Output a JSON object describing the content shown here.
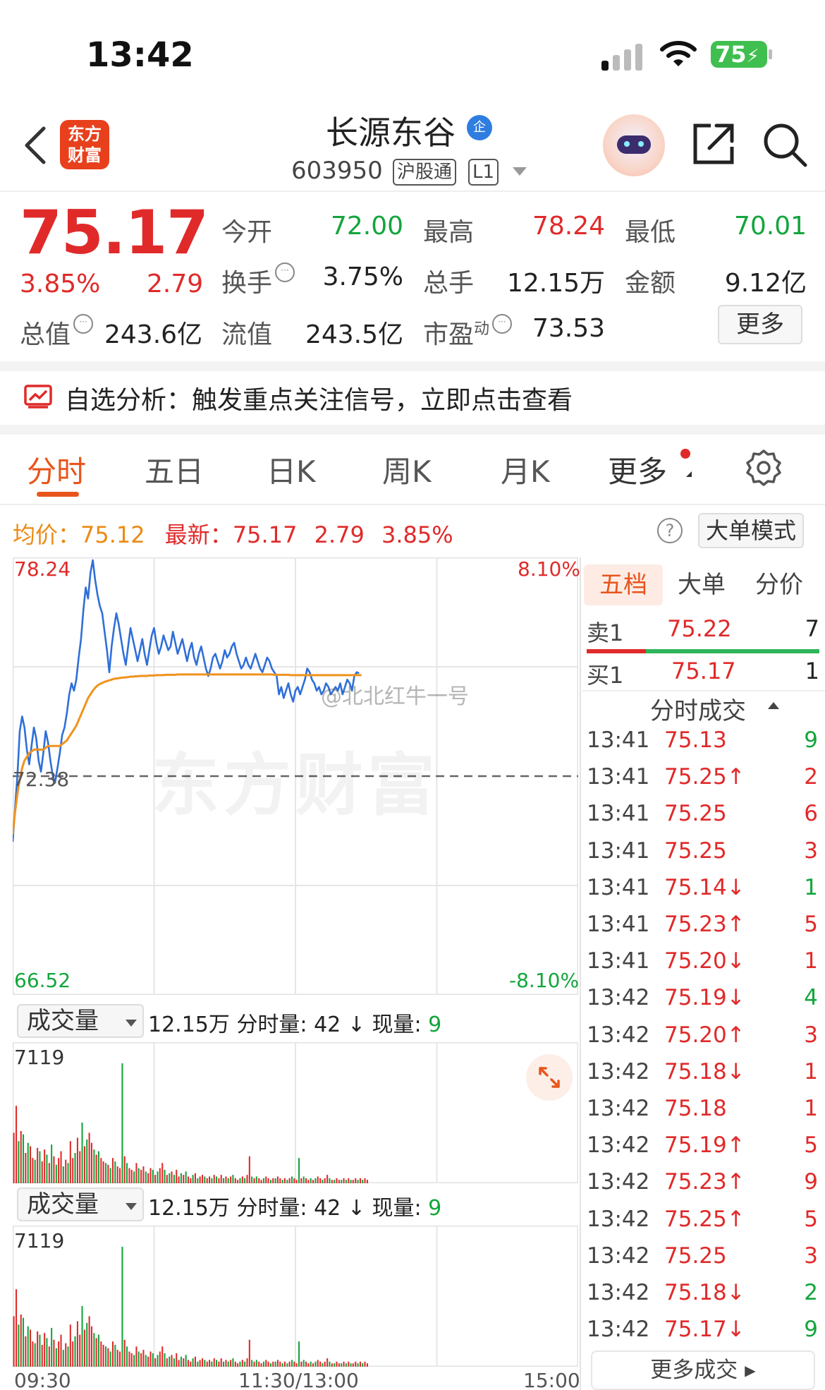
{
  "status": {
    "time": "13:42",
    "battery": "75"
  },
  "header": {
    "logo_line1": "东方",
    "logo_line2": "财富",
    "stock_name": "长源东谷",
    "verified_badge": "企",
    "stock_code": "603950",
    "tag_connect": "沪股通",
    "tag_level": "L1"
  },
  "quote": {
    "price": "75.17",
    "change_pct": "3.85%",
    "change_amt": "2.79",
    "total_value_label": "总值",
    "total_value": "243.6亿",
    "open_label": "今开",
    "open": "72.00",
    "high_label": "最高",
    "high": "78.24",
    "low_label": "最低",
    "low": "70.01",
    "turnover_label": "换手",
    "turnover": "3.75%",
    "volume_label": "总手",
    "volume": "12.15万",
    "amount_label": "金额",
    "amount": "9.12亿",
    "float_label": "流值",
    "float_value": "243.5亿",
    "pe_label": "市盈",
    "pe_sup": "动",
    "pe": "73.53",
    "more_button": "更多"
  },
  "analysis": {
    "text": "自选分析：触发重点关注信号，立即点击查看"
  },
  "tabs": [
    "分时",
    "五日",
    "日K",
    "周K",
    "月K",
    "更多"
  ],
  "avg_row": {
    "avg_label": "均价：",
    "avg_value": "75.12",
    "latest_label": "最新：",
    "latest_value": "75.17",
    "latest_change": "2.79",
    "latest_pct": "3.85%",
    "help": "?",
    "bigorder_button": "大单模式"
  },
  "watermark": {
    "user": "@北北红牛一号",
    "brand": "东方财富"
  },
  "chart_data": {
    "type": "line",
    "y_max_label": "78.24",
    "y_min_label": "66.52",
    "pct_max_label": "8.10%",
    "pct_min_label": "-8.10%",
    "prev_close_label": "72.38",
    "ylim": [
      66.52,
      78.24
    ],
    "prev_close": 72.38,
    "x_ticks": [
      "09:30",
      "11:30/13:00",
      "15:00"
    ],
    "total_minutes": 240,
    "series": [
      {
        "color": "#2f6fd8",
        "values": [
          70.6,
          71.5,
          72.4,
          73.6,
          74.0,
          73.7,
          73.1,
          72.7,
          73.2,
          73.7,
          73.4,
          72.8,
          72.5,
          73.0,
          73.6,
          73.3,
          72.8,
          72.4,
          72.2,
          72.6,
          73.0,
          73.5,
          73.7,
          74.1,
          74.6,
          74.9,
          74.7,
          75.0,
          75.6,
          76.1,
          76.9,
          77.5,
          77.2,
          77.9,
          78.24,
          77.7,
          77.3,
          77.0,
          76.8,
          76.3,
          75.8,
          75.2,
          75.9,
          76.4,
          76.8,
          76.5,
          76.1,
          75.7,
          75.4,
          75.9,
          76.4,
          76.1,
          75.8,
          75.5,
          75.8,
          76.1,
          75.7,
          75.4,
          75.8,
          76.2,
          76.4,
          76.0,
          75.7,
          75.9,
          76.2,
          76.0,
          75.8,
          75.9,
          76.3,
          76.0,
          75.7,
          75.9,
          76.1,
          75.8,
          75.5,
          75.8,
          76.0,
          75.6,
          75.4,
          75.7,
          75.9,
          75.6,
          75.3,
          75.1,
          75.3,
          75.6,
          75.7,
          75.5,
          75.3,
          75.5,
          75.8,
          75.6,
          75.7,
          75.9,
          76.0,
          75.7,
          75.5,
          75.3,
          75.4,
          75.6,
          75.4,
          75.3,
          75.5,
          75.7,
          75.5,
          75.3,
          75.2,
          75.4,
          75.6,
          75.5,
          75.3,
          75.2,
          75.1,
          74.6,
          74.8,
          74.5,
          74.7,
          74.9,
          74.6,
          74.4,
          74.7,
          74.8,
          74.6,
          74.8,
          75.0,
          75.3,
          75.2,
          75.0,
          74.9,
          74.7,
          74.8,
          74.6,
          74.7,
          74.9,
          74.8,
          74.6,
          74.7,
          74.8,
          74.7,
          74.9,
          74.6,
          74.8,
          75.0,
          74.9,
          74.7,
          75.1,
          75.2,
          75.17
        ]
      },
      {
        "color": "#f0921c",
        "values": [
          70.8,
          71.4,
          71.9,
          72.3,
          72.6,
          72.8,
          72.9,
          73.0,
          73.05,
          73.1,
          73.1,
          73.1,
          73.1,
          73.1,
          73.15,
          73.2,
          73.2,
          73.2,
          73.2,
          73.2,
          73.2,
          73.25,
          73.3,
          73.35,
          73.45,
          73.55,
          73.65,
          73.75,
          73.9,
          74.05,
          74.2,
          74.35,
          74.5,
          74.6,
          74.7,
          74.78,
          74.84,
          74.88,
          74.91,
          74.94,
          74.96,
          74.98,
          75.0,
          75.02,
          75.03,
          75.04,
          75.05,
          75.06,
          75.06,
          75.07,
          75.08,
          75.08,
          75.09,
          75.09,
          75.1,
          75.1,
          75.1,
          75.1,
          75.11,
          75.11,
          75.11,
          75.12,
          75.12,
          75.12,
          75.12,
          75.13,
          75.13,
          75.13,
          75.13,
          75.13,
          75.14,
          75.14,
          75.14,
          75.14,
          75.14,
          75.14,
          75.14,
          75.14,
          75.14,
          75.14,
          75.14,
          75.14,
          75.14,
          75.14,
          75.14,
          75.14,
          75.14,
          75.14,
          75.14,
          75.14,
          75.14,
          75.14,
          75.14,
          75.14,
          75.14,
          75.14,
          75.14,
          75.14,
          75.14,
          75.14,
          75.14,
          75.14,
          75.14,
          75.14,
          75.14,
          75.14,
          75.14,
          75.14,
          75.14,
          75.14,
          75.14,
          75.13,
          75.13,
          75.13,
          75.13,
          75.13,
          75.13,
          75.13,
          75.12,
          75.12,
          75.12,
          75.12,
          75.12,
          75.12,
          75.12,
          75.12,
          75.12,
          75.12,
          75.12,
          75.12,
          75.12,
          75.12,
          75.12,
          75.12,
          75.12,
          75.12,
          75.12,
          75.12,
          75.12,
          75.12,
          75.12,
          75.12,
          75.12,
          75.12,
          75.12,
          75.12,
          75.12,
          75.12,
          75.12
        ]
      }
    ]
  },
  "volume_data": {
    "type": "bar",
    "button_label": "成交量",
    "total": "12.15万",
    "minute_label": "分时量:",
    "minute_value": "42",
    "minute_arrow": "↓",
    "current_label": "现量:",
    "current_value": "9",
    "y_max_label": "7119",
    "ymax": 7119,
    "total_minutes": 240,
    "values": [
      3000,
      4600,
      2500,
      3100,
      2900,
      1800,
      2400,
      2200,
      1500,
      1400,
      2100,
      1900,
      1300,
      2000,
      1700,
      1200,
      2300,
      1600,
      1100,
      1500,
      1900,
      1000,
      1400,
      1200,
      2500,
      1500,
      1800,
      2700,
      1900,
      3600,
      2200,
      2600,
      3000,
      2400,
      2000,
      1700,
      1900,
      1500,
      1300,
      1200,
      1100,
      900,
      1500,
      1300,
      1000,
      900,
      7119,
      1600,
      1200,
      900,
      800,
      700,
      1200,
      900,
      800,
      1000,
      700,
      600,
      900,
      800,
      500,
      700,
      900,
      1200,
      800,
      500,
      600,
      700,
      500,
      800,
      400,
      600,
      500,
      700,
      400,
      300,
      500,
      600,
      300,
      400,
      500,
      400,
      300,
      400,
      300,
      500,
      400,
      300,
      500,
      300,
      400,
      300,
      400,
      500,
      300,
      200,
      300,
      400,
      300,
      500,
      1600,
      400,
      300,
      400,
      300,
      200,
      300,
      400,
      300,
      200,
      300,
      300,
      400,
      300,
      200,
      300,
      200,
      300,
      400,
      300,
      200,
      1500,
      300,
      400,
      300,
      200,
      300,
      200,
      300,
      400,
      300,
      200,
      300,
      500,
      300,
      200,
      200,
      300,
      200,
      200,
      300,
      200,
      300,
      200,
      200,
      300,
      200,
      300,
      200,
      300,
      200
    ],
    "colors": [
      "r",
      "r",
      "g",
      "r",
      "g",
      "r",
      "g",
      "r",
      "r",
      "g",
      "r",
      "g",
      "r",
      "r",
      "g",
      "r",
      "g",
      "r",
      "g",
      "r",
      "r",
      "g",
      "r",
      "g",
      "r",
      "r",
      "g",
      "r",
      "r",
      "g",
      "r",
      "g",
      "r",
      "r",
      "g",
      "r",
      "g",
      "r",
      "r",
      "g",
      "r",
      "g",
      "r",
      "g",
      "r",
      "r",
      "g",
      "r",
      "g",
      "r",
      "r",
      "g",
      "r",
      "g",
      "r",
      "r",
      "g",
      "r",
      "r",
      "g",
      "r",
      "g",
      "r",
      "r",
      "g",
      "r",
      "g",
      "r",
      "g",
      "r",
      "r",
      "g",
      "r",
      "g",
      "r",
      "r",
      "g",
      "r",
      "g",
      "r",
      "r",
      "g",
      "r",
      "r",
      "g",
      "r",
      "g",
      "r",
      "r",
      "g",
      "r",
      "g",
      "r",
      "g",
      "r",
      "r",
      "g",
      "r",
      "g",
      "r",
      "r",
      "g",
      "r",
      "g",
      "r",
      "r",
      "g",
      "r",
      "r",
      "g",
      "r",
      "g",
      "r",
      "r",
      "g",
      "r",
      "g",
      "r",
      "g",
      "r",
      "r",
      "g",
      "r",
      "g",
      "r",
      "r",
      "g",
      "r",
      "g",
      "r",
      "r",
      "g",
      "r",
      "r",
      "g",
      "r",
      "g",
      "r",
      "r",
      "g",
      "r",
      "g",
      "r",
      "g",
      "r",
      "r",
      "g",
      "r",
      "g",
      "r",
      "r",
      "g",
      "r"
    ]
  },
  "panel": {
    "tabs": [
      "五档",
      "大单",
      "分价"
    ],
    "sell1": {
      "label": "卖1",
      "price": "75.22",
      "qty": "7"
    },
    "buy1": {
      "label": "买1",
      "price": "75.17",
      "qty": "1"
    },
    "trade_title": "分时成交",
    "trades": [
      {
        "t": "13:41",
        "p": "75.13",
        "v": "9",
        "pc": "r",
        "vc": "g"
      },
      {
        "t": "13:41",
        "p": "75.25↑",
        "v": "2",
        "pc": "r",
        "vc": "r"
      },
      {
        "t": "13:41",
        "p": "75.25",
        "v": "6",
        "pc": "r",
        "vc": "r"
      },
      {
        "t": "13:41",
        "p": "75.25",
        "v": "3",
        "pc": "r",
        "vc": "r"
      },
      {
        "t": "13:41",
        "p": "75.14↓",
        "v": "1",
        "pc": "r",
        "vc": "g"
      },
      {
        "t": "13:41",
        "p": "75.23↑",
        "v": "5",
        "pc": "r",
        "vc": "r"
      },
      {
        "t": "13:41",
        "p": "75.20↓",
        "v": "1",
        "pc": "r",
        "vc": "r"
      },
      {
        "t": "13:42",
        "p": "75.19↓",
        "v": "4",
        "pc": "r",
        "vc": "g"
      },
      {
        "t": "13:42",
        "p": "75.20↑",
        "v": "3",
        "pc": "r",
        "vc": "r"
      },
      {
        "t": "13:42",
        "p": "75.18↓",
        "v": "1",
        "pc": "r",
        "vc": "r"
      },
      {
        "t": "13:42",
        "p": "75.18",
        "v": "1",
        "pc": "r",
        "vc": "r"
      },
      {
        "t": "13:42",
        "p": "75.19↑",
        "v": "5",
        "pc": "r",
        "vc": "r"
      },
      {
        "t": "13:42",
        "p": "75.23↑",
        "v": "9",
        "pc": "r",
        "vc": "r"
      },
      {
        "t": "13:42",
        "p": "75.25↑",
        "v": "5",
        "pc": "r",
        "vc": "r"
      },
      {
        "t": "13:42",
        "p": "75.25",
        "v": "3",
        "pc": "r",
        "vc": "r"
      },
      {
        "t": "13:42",
        "p": "75.18↓",
        "v": "2",
        "pc": "r",
        "vc": "g"
      },
      {
        "t": "13:42",
        "p": "75.17↓",
        "v": "9",
        "pc": "r",
        "vc": "g"
      }
    ],
    "more_trades": "更多成交 ▸"
  }
}
